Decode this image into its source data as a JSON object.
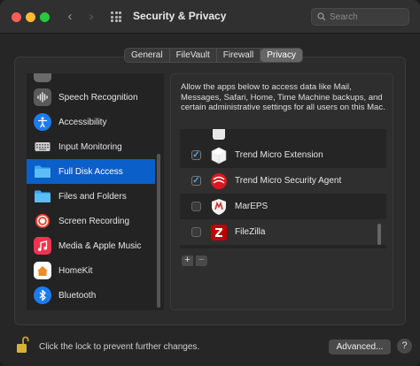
{
  "window": {
    "title": "Security & Privacy",
    "search_placeholder": "Search"
  },
  "tabs": [
    {
      "label": "General",
      "active": false
    },
    {
      "label": "FileVault",
      "active": false
    },
    {
      "label": "Firewall",
      "active": false
    },
    {
      "label": "Privacy",
      "active": true
    }
  ],
  "sidebar": {
    "items": [
      {
        "label": "Speech Recognition",
        "icon": "waveform-icon",
        "color": "#5a5a5a"
      },
      {
        "label": "Accessibility",
        "icon": "accessibility-icon",
        "color": "#1b7cf2"
      },
      {
        "label": "Input Monitoring",
        "icon": "keyboard-icon",
        "color": "#9a9a9a"
      },
      {
        "label": "Full Disk Access",
        "icon": "folder-icon",
        "color": "#3aa8f0",
        "selected": true
      },
      {
        "label": "Files and Folders",
        "icon": "folder-icon",
        "color": "#3aa8f0"
      },
      {
        "label": "Screen Recording",
        "icon": "record-icon",
        "color": "#e8432e"
      },
      {
        "label": "Media & Apple Music",
        "icon": "music-icon",
        "color": "#f0334e"
      },
      {
        "label": "HomeKit",
        "icon": "home-icon",
        "color": "#f08a24"
      },
      {
        "label": "Bluetooth",
        "icon": "bluetooth-icon",
        "color": "#1b7cf2"
      }
    ]
  },
  "panel": {
    "description": "Allow the apps below to access data like Mail, Messages, Safari, Home, Time Machine backups, and certain administrative settings for all users on this Mac.",
    "apps": [
      {
        "label": "Trend Micro Extension",
        "checked": true,
        "icon": "trend-micro-extension-icon"
      },
      {
        "label": "Trend Micro Security Agent",
        "checked": true,
        "icon": "trend-micro-agent-icon"
      },
      {
        "label": "MarEPS",
        "checked": false,
        "icon": "mareps-icon"
      },
      {
        "label": "FileZilla",
        "checked": false,
        "icon": "filezilla-icon"
      }
    ],
    "add_label": "+",
    "remove_label": "−"
  },
  "footer": {
    "lock_text": "Click the lock to prevent further changes.",
    "advanced_label": "Advanced...",
    "help_label": "?"
  },
  "colors": {
    "accent": "#0a5fc8",
    "checkmark": "#4da3ff"
  }
}
